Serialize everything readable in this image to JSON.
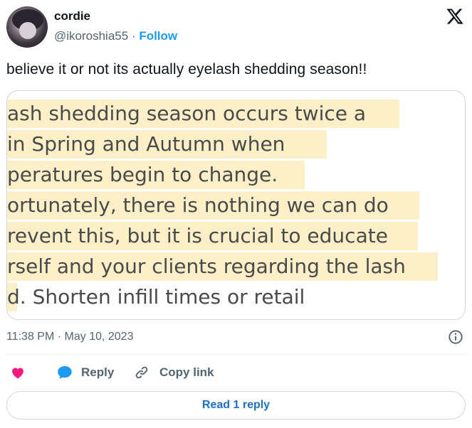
{
  "author": {
    "display_name": "cordie",
    "handle": "@ikoroshia55",
    "separator": " · ",
    "follow_label": "Follow"
  },
  "tweet": {
    "text": "believe it or not its actually eyelash shedding season!!"
  },
  "media_text_lines": [
    "ash shedding season occurs twice a",
    " in Spring and Autumn when",
    "peratures begin to change.",
    "ortunately, there is nothing we can do",
    "revent this, but it is crucial to educate",
    "rself and your clients regarding the lash",
    "d. Shorten infill times or retail"
  ],
  "meta": {
    "timestamp": "11:38 PM · May 10, 2023"
  },
  "actions": {
    "reply_label": "Reply",
    "copy_link_label": "Copy link"
  },
  "read_replies_label": "Read 1 reply",
  "colors": {
    "link_blue": "#1d9bf0",
    "like_pink": "#f91880",
    "highlight": "#fdefc8",
    "muted_gray": "#536471"
  },
  "icons": [
    "x-logo-icon",
    "info-icon",
    "heart-icon",
    "reply-bubble-icon",
    "link-icon"
  ]
}
